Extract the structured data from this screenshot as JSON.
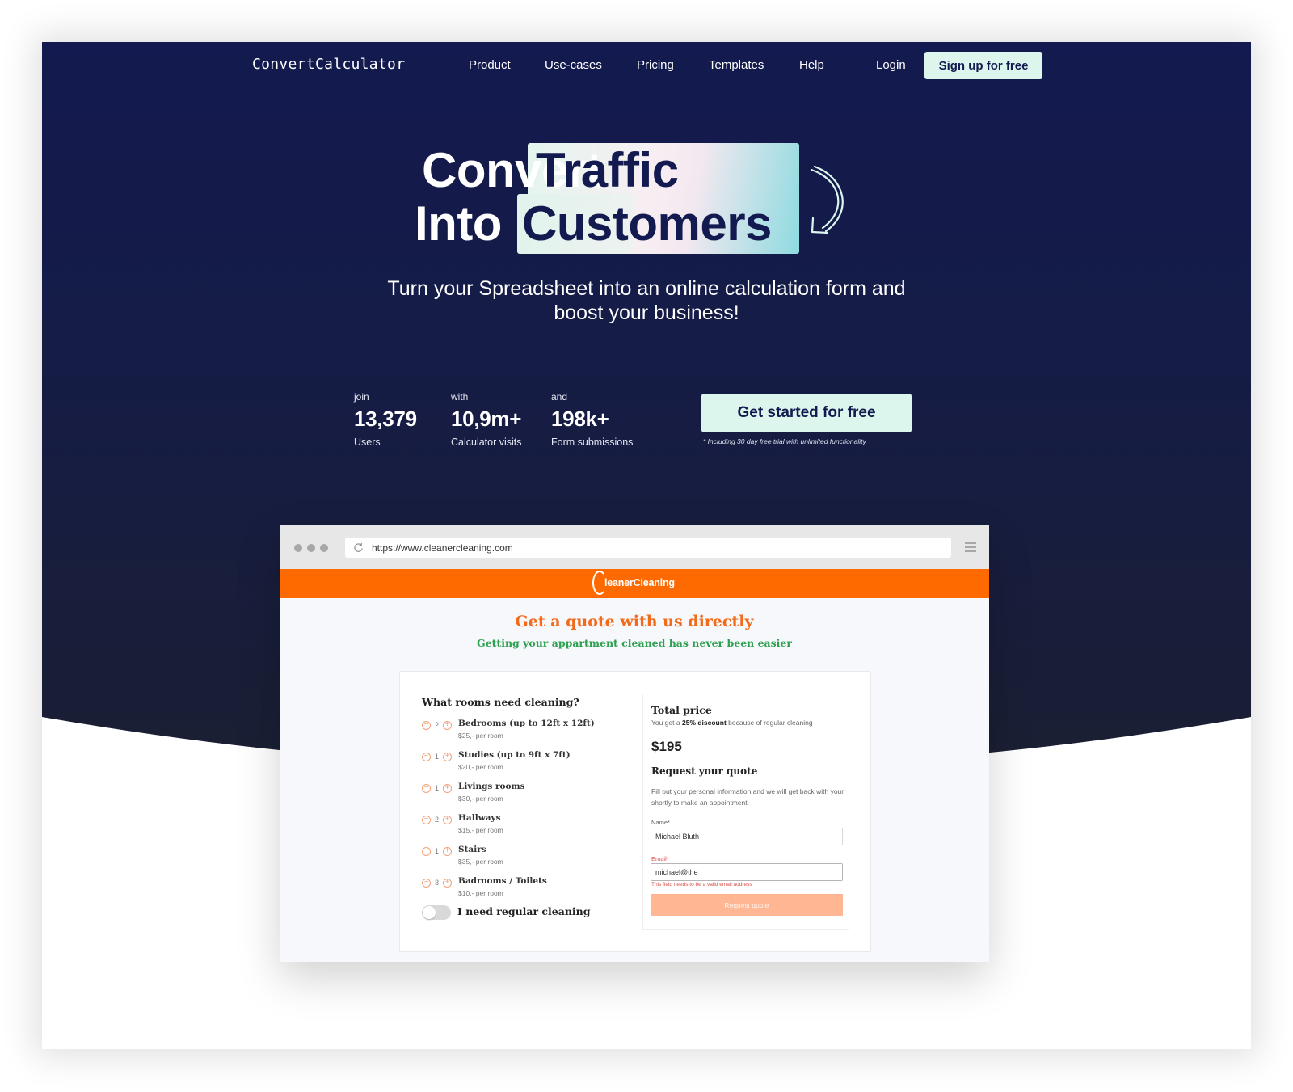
{
  "nav": {
    "logo": "ConvertCalculator",
    "links": [
      "Product",
      "Use-cases",
      "Pricing",
      "Templates",
      "Help"
    ],
    "login": "Login",
    "signup": "Sign up for free"
  },
  "hero": {
    "line1_plain": "Convert",
    "line1_highlight": "Traffic",
    "line2_plain": "Into",
    "line2_highlight": "Customers",
    "subtitle_line1": "Turn your Spreadsheet into an online calculation form and",
    "subtitle_line2": "boost your business!",
    "accent_color": "#dcf6ee",
    "background_color": "#131a4f"
  },
  "stats": [
    {
      "prefix": "join",
      "value": "13,379",
      "label": "Users"
    },
    {
      "prefix": "with",
      "value": "10,9m+",
      "label": "Calculator visits"
    },
    {
      "prefix": "and",
      "value": "198k+",
      "label": "Form submissions"
    }
  ],
  "cta": {
    "label": "Get started for free",
    "note": "* Including 30 day free trial with unlimited functionality"
  },
  "browser": {
    "url": "https://www.cleanercleaning.com",
    "brand": "leanerCleaning",
    "brand_color": "#ff6a00",
    "title": "Get a quote with us directly",
    "subtitle": "Getting your appartment cleaned has never been easier",
    "rooms_title": "What rooms need cleaning?",
    "rooms": [
      {
        "name": "Bedrooms (up to 12ft x 12ft)",
        "price": "$25,- per room",
        "qty": "2"
      },
      {
        "name": "Studies (up to 9ft x 7ft)",
        "price": "$20,- per room",
        "qty": "1"
      },
      {
        "name": "Livings rooms",
        "price": "$30,- per room",
        "qty": "1"
      },
      {
        "name": "Hallways",
        "price": "$15,- per room",
        "qty": "2"
      },
      {
        "name": "Stairs",
        "price": "$35,- per room",
        "qty": "1"
      },
      {
        "name": "Badrooms / Toilets",
        "price": "$10,- per room",
        "qty": "3"
      }
    ],
    "toggle_label": "I need regular cleaning",
    "toggle_on": false,
    "total_title": "Total price",
    "discount_pre": "You get a ",
    "discount_bold": "25% discount",
    "discount_post": " because of regular cleaning",
    "total_price": "$195",
    "request_title": "Request your quote",
    "request_desc": "Fill out your personal information and we will get back with your shortly to make an appointment.",
    "name_label": "Name*",
    "name_value": "Michael Bluth",
    "email_label": "Email*",
    "email_value": "michael@the",
    "email_error": "This field needs to be a valid email address",
    "request_button": "Request quote"
  }
}
